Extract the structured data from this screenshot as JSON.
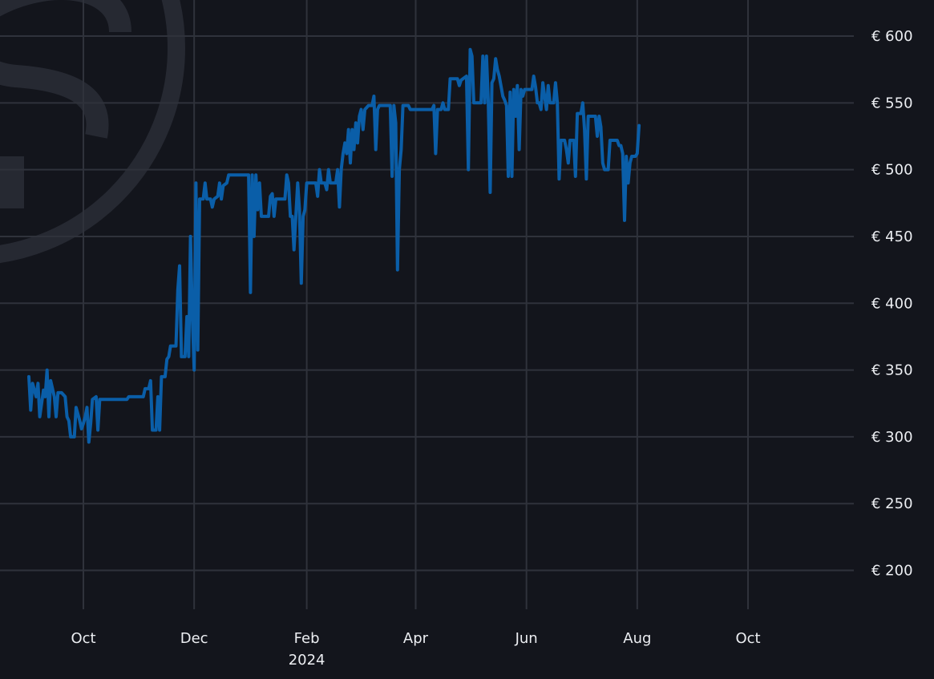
{
  "colors": {
    "background": "#13151c",
    "grid": "#2f323b",
    "text": "#eceef2",
    "series": "#0a5ea8",
    "watermark": "#262932"
  },
  "watermark": {
    "icon": "brand-logo-icon"
  },
  "chart_data": {
    "type": "line",
    "title": "",
    "xlabel": "",
    "ylabel": "",
    "ylim": [
      160,
      620
    ],
    "grid": true,
    "y_axis_position": "right",
    "y_ticks": [
      {
        "value": 200,
        "label": "€ 200"
      },
      {
        "value": 250,
        "label": "€ 250"
      },
      {
        "value": 300,
        "label": "€ 300"
      },
      {
        "value": 350,
        "label": "€ 350"
      },
      {
        "value": 400,
        "label": "€ 400"
      },
      {
        "value": 450,
        "label": "€ 450"
      },
      {
        "value": 500,
        "label": "€ 500"
      },
      {
        "value": 550,
        "label": "€ 550"
      },
      {
        "value": 600,
        "label": "€ 600"
      }
    ],
    "x_range": [
      "2023-09-01",
      "2024-12-01"
    ],
    "x_ticks": [
      {
        "date": "2023-10-01",
        "label": "Oct"
      },
      {
        "date": "2023-12-01",
        "label": "Dec"
      },
      {
        "date": "2024-02-01",
        "label": "Feb",
        "sublabel": "2024"
      },
      {
        "date": "2024-04-01",
        "label": "Apr"
      },
      {
        "date": "2024-06-01",
        "label": "Jun"
      },
      {
        "date": "2024-08-01",
        "label": "Aug"
      },
      {
        "date": "2024-10-01",
        "label": "Oct"
      }
    ],
    "series": [
      {
        "color": "#0a5ea8",
        "points": [
          [
            "2023-09-01",
            345
          ],
          [
            "2023-09-02",
            320
          ],
          [
            "2023-09-03",
            340
          ],
          [
            "2023-09-05",
            330
          ],
          [
            "2023-09-06",
            340
          ],
          [
            "2023-09-07",
            315
          ],
          [
            "2023-09-09",
            335
          ],
          [
            "2023-09-10",
            330
          ],
          [
            "2023-09-11",
            350
          ],
          [
            "2023-09-12",
            315
          ],
          [
            "2023-09-13",
            342
          ],
          [
            "2023-09-15",
            330
          ],
          [
            "2023-09-16",
            315
          ],
          [
            "2023-09-17",
            333
          ],
          [
            "2023-09-19",
            333
          ],
          [
            "2023-09-21",
            330
          ],
          [
            "2023-09-22",
            315
          ],
          [
            "2023-09-23",
            312
          ],
          [
            "2023-09-24",
            300
          ],
          [
            "2023-09-26",
            300
          ],
          [
            "2023-09-27",
            322
          ],
          [
            "2023-09-29",
            312
          ],
          [
            "2023-09-30",
            306
          ],
          [
            "2023-10-01",
            310
          ],
          [
            "2023-10-02",
            315
          ],
          [
            "2023-10-03",
            322
          ],
          [
            "2023-10-04",
            296
          ],
          [
            "2023-10-05",
            310
          ],
          [
            "2023-10-06",
            328
          ],
          [
            "2023-10-08",
            330
          ],
          [
            "2023-10-09",
            305
          ],
          [
            "2023-10-10",
            328
          ],
          [
            "2023-10-25",
            328
          ],
          [
            "2023-10-26",
            330
          ],
          [
            "2023-11-03",
            330
          ],
          [
            "2023-11-04",
            336
          ],
          [
            "2023-11-06",
            336
          ],
          [
            "2023-11-07",
            342
          ],
          [
            "2023-11-08",
            305
          ],
          [
            "2023-11-10",
            305
          ],
          [
            "2023-11-11",
            330
          ],
          [
            "2023-11-12",
            305
          ],
          [
            "2023-11-13",
            345
          ],
          [
            "2023-11-15",
            345
          ],
          [
            "2023-11-16",
            358
          ],
          [
            "2023-11-17",
            360
          ],
          [
            "2023-11-18",
            368
          ],
          [
            "2023-11-21",
            368
          ],
          [
            "2023-11-22",
            410
          ],
          [
            "2023-11-23",
            428
          ],
          [
            "2023-11-24",
            360
          ],
          [
            "2023-11-26",
            360
          ],
          [
            "2023-11-27",
            390
          ],
          [
            "2023-11-28",
            360
          ],
          [
            "2023-11-29",
            450
          ],
          [
            "2023-11-30",
            390
          ],
          [
            "2023-12-01",
            350
          ],
          [
            "2023-12-02",
            490
          ],
          [
            "2023-12-03",
            365
          ],
          [
            "2023-12-04",
            478
          ],
          [
            "2023-12-06",
            478
          ],
          [
            "2023-12-07",
            490
          ],
          [
            "2023-12-08",
            478
          ],
          [
            "2023-12-10",
            478
          ],
          [
            "2023-12-11",
            472
          ],
          [
            "2023-12-12",
            478
          ],
          [
            "2023-12-14",
            480
          ],
          [
            "2023-12-15",
            490
          ],
          [
            "2023-12-16",
            478
          ],
          [
            "2023-12-17",
            488
          ],
          [
            "2023-12-19",
            490
          ],
          [
            "2023-12-20",
            496
          ],
          [
            "2023-12-31",
            496
          ],
          [
            "2024-01-01",
            408
          ],
          [
            "2024-01-02",
            496
          ],
          [
            "2024-01-03",
            450
          ],
          [
            "2024-01-04",
            496
          ],
          [
            "2024-01-05",
            470
          ],
          [
            "2024-01-06",
            490
          ],
          [
            "2024-01-07",
            465
          ],
          [
            "2024-01-11",
            465
          ],
          [
            "2024-01-12",
            480
          ],
          [
            "2024-01-13",
            482
          ],
          [
            "2024-01-14",
            465
          ],
          [
            "2024-01-15",
            478
          ],
          [
            "2024-01-20",
            478
          ],
          [
            "2024-01-21",
            496
          ],
          [
            "2024-01-22",
            490
          ],
          [
            "2024-01-23",
            465
          ],
          [
            "2024-01-24",
            465
          ],
          [
            "2024-01-25",
            440
          ],
          [
            "2024-01-26",
            465
          ],
          [
            "2024-01-27",
            490
          ],
          [
            "2024-01-28",
            470
          ],
          [
            "2024-01-29",
            415
          ],
          [
            "2024-01-30",
            465
          ],
          [
            "2024-01-31",
            470
          ],
          [
            "2024-02-01",
            490
          ],
          [
            "2024-02-06",
            490
          ],
          [
            "2024-02-07",
            480
          ],
          [
            "2024-02-08",
            500
          ],
          [
            "2024-02-09",
            490
          ],
          [
            "2024-02-11",
            490
          ],
          [
            "2024-02-12",
            485
          ],
          [
            "2024-02-13",
            500
          ],
          [
            "2024-02-14",
            490
          ],
          [
            "2024-02-17",
            490
          ],
          [
            "2024-02-18",
            500
          ],
          [
            "2024-02-19",
            472
          ],
          [
            "2024-02-20",
            500
          ],
          [
            "2024-02-21",
            512
          ],
          [
            "2024-02-22",
            520
          ],
          [
            "2024-02-23",
            512
          ],
          [
            "2024-02-24",
            530
          ],
          [
            "2024-02-25",
            505
          ],
          [
            "2024-02-26",
            530
          ],
          [
            "2024-02-27",
            515
          ],
          [
            "2024-02-28",
            535
          ],
          [
            "2024-02-29",
            520
          ],
          [
            "2024-03-01",
            540
          ],
          [
            "2024-03-02",
            545
          ],
          [
            "2024-03-03",
            530
          ],
          [
            "2024-03-04",
            545
          ],
          [
            "2024-03-06",
            548
          ],
          [
            "2024-03-08",
            548
          ],
          [
            "2024-03-09",
            555
          ],
          [
            "2024-03-10",
            515
          ],
          [
            "2024-03-11",
            545
          ],
          [
            "2024-03-12",
            548
          ],
          [
            "2024-03-18",
            548
          ],
          [
            "2024-03-19",
            495
          ],
          [
            "2024-03-20",
            548
          ],
          [
            "2024-03-21",
            535
          ],
          [
            "2024-03-22",
            425
          ],
          [
            "2024-03-23",
            500
          ],
          [
            "2024-03-24",
            515
          ],
          [
            "2024-03-25",
            548
          ],
          [
            "2024-03-28",
            548
          ],
          [
            "2024-03-29",
            545
          ],
          [
            "2024-04-10",
            545
          ],
          [
            "2024-04-11",
            548
          ],
          [
            "2024-04-12",
            512
          ],
          [
            "2024-04-13",
            545
          ],
          [
            "2024-04-15",
            545
          ],
          [
            "2024-04-16",
            550
          ],
          [
            "2024-04-17",
            545
          ],
          [
            "2024-04-19",
            545
          ],
          [
            "2024-04-20",
            568
          ],
          [
            "2024-04-24",
            568
          ],
          [
            "2024-04-25",
            563
          ],
          [
            "2024-04-26",
            567
          ],
          [
            "2024-04-29",
            570
          ],
          [
            "2024-04-30",
            500
          ],
          [
            "2024-05-01",
            590
          ],
          [
            "2024-05-02",
            585
          ],
          [
            "2024-05-03",
            550
          ],
          [
            "2024-05-07",
            550
          ],
          [
            "2024-05-08",
            585
          ],
          [
            "2024-05-09",
            550
          ],
          [
            "2024-05-10",
            585
          ],
          [
            "2024-05-11",
            550
          ],
          [
            "2024-05-12",
            483
          ],
          [
            "2024-05-13",
            565
          ],
          [
            "2024-05-14",
            568
          ],
          [
            "2024-05-15",
            583
          ],
          [
            "2024-05-16",
            575
          ],
          [
            "2024-05-17",
            570
          ],
          [
            "2024-05-19",
            555
          ],
          [
            "2024-05-20",
            552
          ],
          [
            "2024-05-21",
            548
          ],
          [
            "2024-05-22",
            495
          ],
          [
            "2024-05-23",
            558
          ],
          [
            "2024-05-24",
            495
          ],
          [
            "2024-05-25",
            560
          ],
          [
            "2024-05-26",
            540
          ],
          [
            "2024-05-27",
            563
          ],
          [
            "2024-05-28",
            515
          ],
          [
            "2024-05-29",
            560
          ],
          [
            "2024-05-30",
            555
          ],
          [
            "2024-05-31",
            560
          ],
          [
            "2024-06-04",
            560
          ],
          [
            "2024-06-05",
            570
          ],
          [
            "2024-06-06",
            562
          ],
          [
            "2024-06-07",
            550
          ],
          [
            "2024-06-08",
            550
          ],
          [
            "2024-06-09",
            545
          ],
          [
            "2024-06-10",
            565
          ],
          [
            "2024-06-11",
            555
          ],
          [
            "2024-06-12",
            545
          ],
          [
            "2024-06-13",
            563
          ],
          [
            "2024-06-14",
            550
          ],
          [
            "2024-06-16",
            550
          ],
          [
            "2024-06-17",
            565
          ],
          [
            "2024-06-18",
            550
          ],
          [
            "2024-06-19",
            493
          ],
          [
            "2024-06-20",
            522
          ],
          [
            "2024-06-22",
            522
          ],
          [
            "2024-06-23",
            515
          ],
          [
            "2024-06-24",
            505
          ],
          [
            "2024-06-25",
            522
          ],
          [
            "2024-06-27",
            522
          ],
          [
            "2024-06-28",
            495
          ],
          [
            "2024-06-29",
            542
          ],
          [
            "2024-07-01",
            542
          ],
          [
            "2024-07-02",
            550
          ],
          [
            "2024-07-03",
            530
          ],
          [
            "2024-07-04",
            493
          ],
          [
            "2024-07-05",
            540
          ],
          [
            "2024-07-09",
            540
          ],
          [
            "2024-07-10",
            525
          ],
          [
            "2024-07-11",
            540
          ],
          [
            "2024-07-12",
            532
          ],
          [
            "2024-07-13",
            505
          ],
          [
            "2024-07-14",
            500
          ],
          [
            "2024-07-16",
            500
          ],
          [
            "2024-07-17",
            522
          ],
          [
            "2024-07-21",
            522
          ],
          [
            "2024-07-22",
            518
          ],
          [
            "2024-07-23",
            518
          ],
          [
            "2024-07-24",
            512
          ],
          [
            "2024-07-25",
            462
          ],
          [
            "2024-07-26",
            510
          ],
          [
            "2024-07-27",
            490
          ],
          [
            "2024-07-28",
            505
          ],
          [
            "2024-07-29",
            510
          ],
          [
            "2024-07-31",
            510
          ],
          [
            "2024-08-01",
            512
          ],
          [
            "2024-08-02",
            533
          ]
        ]
      }
    ]
  }
}
